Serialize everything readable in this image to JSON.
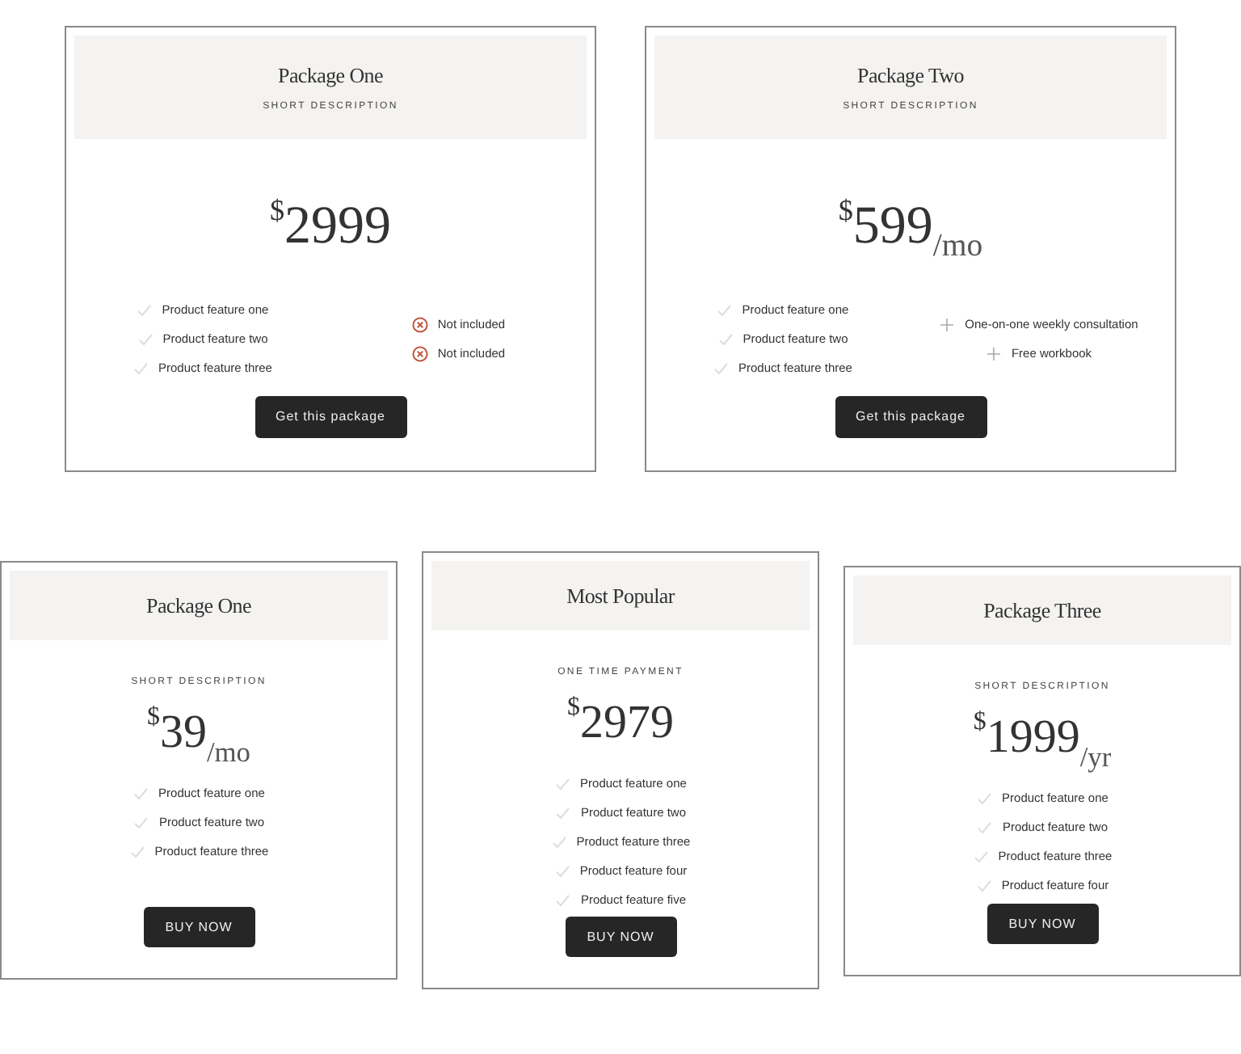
{
  "rows": [
    {
      "cards": [
        {
          "kind": "header",
          "title": "Package One",
          "description": "SHORT DESCRIPTION",
          "price": {
            "currency": "$",
            "amount": "2999"
          },
          "features": [
            {
              "text": "Product feature one"
            },
            {
              "text": "Product feature two"
            },
            {
              "text": "Product feature three"
            }
          ],
          "extras": [
            {
              "kind": "cross",
              "text": "Not included"
            },
            {
              "kind": "cross",
              "text": "Not included"
            }
          ],
          "button": "Get this package"
        },
        {
          "kind": "header",
          "title": "Package Two",
          "description": "SHORT DESCRIPTION",
          "price": {
            "currency": "$",
            "amount": "599",
            "period": "/mo"
          },
          "features": [
            {
              "text": "Product feature one"
            },
            {
              "text": "Product feature two"
            },
            {
              "text": "Product feature three"
            }
          ],
          "extras": [
            {
              "kind": "plus",
              "text": "One-on-one weekly consultation"
            },
            {
              "kind": "plus",
              "text": "Free workbook"
            }
          ],
          "button": "Get this package"
        }
      ]
    },
    {
      "cards": [
        {
          "kind": "body",
          "title": "Package One",
          "description": "SHORT DESCRIPTION",
          "price": {
            "currency": "$",
            "amount": "39",
            "period": "/mo"
          },
          "features": [
            {
              "text": "Product feature one"
            },
            {
              "text": "Product feature two"
            },
            {
              "text": "Product feature three"
            }
          ],
          "button": "BUY NOW"
        },
        {
          "kind": "body",
          "title": "Most Popular",
          "description": "ONE TIME PAYMENT",
          "price": {
            "currency": "$",
            "amount": "2979"
          },
          "features": [
            {
              "text": "Product feature one"
            },
            {
              "text": "Product feature two"
            },
            {
              "text": "Product feature three"
            },
            {
              "text": "Product feature four"
            },
            {
              "text": "Product feature five"
            }
          ],
          "button": "BUY NOW"
        },
        {
          "kind": "body",
          "title": "Package Three",
          "description": "SHORT DESCRIPTION",
          "price": {
            "currency": "$",
            "amount": "1999",
            "period": "/yr"
          },
          "features": [
            {
              "text": "Product feature one"
            },
            {
              "text": "Product feature two"
            },
            {
              "text": "Product feature three"
            },
            {
              "text": "Product feature four"
            }
          ],
          "button": "BUY NOW"
        }
      ]
    }
  ]
}
